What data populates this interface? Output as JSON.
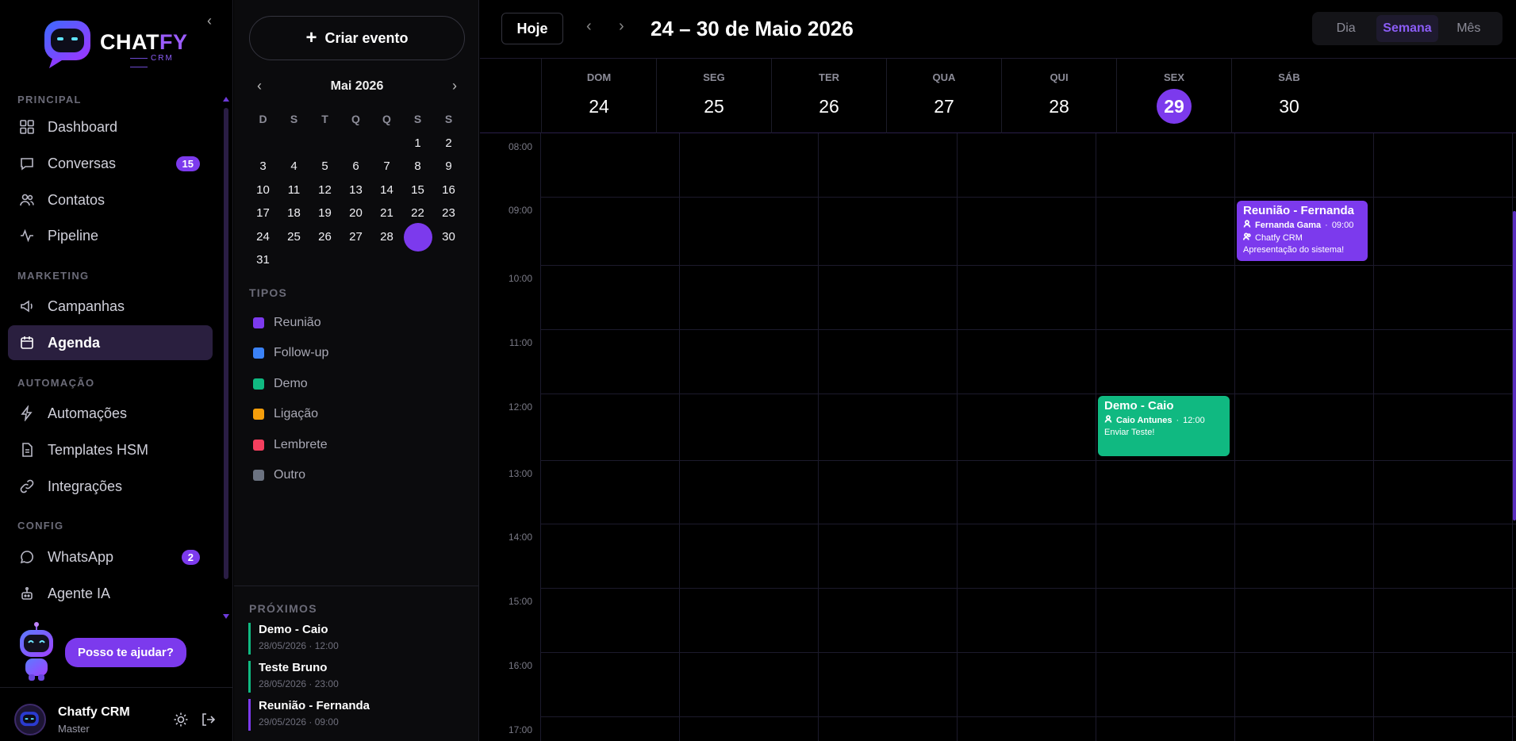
{
  "brand": {
    "name_main": "CHAT",
    "name_accent": "FY",
    "sub": "CRM"
  },
  "sidebar": {
    "collapse_icon": "chevron-left-icon",
    "sections": {
      "principal": "PRINCIPAL",
      "marketing": "MARKETING",
      "automacao": "AUTOMAÇÃO",
      "config": "CONFIG"
    },
    "items": [
      {
        "label": "Dashboard",
        "icon": "grid-icon"
      },
      {
        "label": "Conversas",
        "icon": "chat-icon",
        "badge": "15"
      },
      {
        "label": "Contatos",
        "icon": "users-icon"
      },
      {
        "label": "Pipeline",
        "icon": "activity-icon"
      },
      {
        "label": "Campanhas",
        "icon": "megaphone-icon"
      },
      {
        "label": "Agenda",
        "icon": "calendar-icon",
        "active": true
      },
      {
        "label": "Automações",
        "icon": "bolt-icon"
      },
      {
        "label": "Templates HSM",
        "icon": "file-icon"
      },
      {
        "label": "Integrações",
        "icon": "link-icon"
      },
      {
        "label": "WhatsApp",
        "icon": "whatsapp-icon",
        "badge": "2"
      },
      {
        "label": "Agente IA",
        "icon": "robot-icon"
      }
    ],
    "helper": "Posso te ajudar?",
    "profile": {
      "name": "Chatfy CRM",
      "role": "Master"
    }
  },
  "mini": {
    "create": "Criar evento",
    "month_title": "Mai 2026",
    "dow": [
      "D",
      "S",
      "T",
      "Q",
      "Q",
      "S",
      "S"
    ],
    "weeks": [
      [
        "",
        "",
        "",
        "",
        "",
        "1",
        "2"
      ],
      [
        "3",
        "4",
        "5",
        "6",
        "7",
        "8",
        "9"
      ],
      [
        "10",
        "11",
        "12",
        "13",
        "14",
        "15",
        "16"
      ],
      [
        "17",
        "18",
        "19",
        "20",
        "21",
        "22",
        "23"
      ],
      [
        "24",
        "25",
        "26",
        "27",
        "28",
        "",
        "30"
      ],
      [
        "31",
        "",
        "",
        "",
        "",
        "",
        ""
      ]
    ],
    "selected_day": "29",
    "tipos_title": "TIPOS",
    "tipos": [
      {
        "label": "Reunião",
        "color": "#7c3aed"
      },
      {
        "label": "Follow-up",
        "color": "#3b82f6"
      },
      {
        "label": "Demo",
        "color": "#10b981"
      },
      {
        "label": "Ligação",
        "color": "#f59e0b"
      },
      {
        "label": "Lembrete",
        "color": "#f43f5e"
      },
      {
        "label": "Outro",
        "color": "#6b7280"
      }
    ],
    "proximos_title": "PRÓXIMOS",
    "proximos": [
      {
        "name": "Demo - Caio",
        "date": "28/05/2026 · 12:00",
        "color": "#10b981"
      },
      {
        "name": "Teste Bruno",
        "date": "28/05/2026 · 23:00",
        "color": "#10b981"
      },
      {
        "name": "Reunião - Fernanda",
        "date": "29/05/2026 · 09:00",
        "color": "#7c3aed"
      }
    ]
  },
  "toolbar": {
    "today": "Hoje",
    "prev": "‹",
    "next": "›",
    "range": "24 – 30 de Maio 2026",
    "views": [
      "Dia",
      "Semana",
      "Mês"
    ],
    "active_view": "Semana"
  },
  "week": {
    "days": [
      {
        "dow": "DOM",
        "num": "24"
      },
      {
        "dow": "SEG",
        "num": "25"
      },
      {
        "dow": "TER",
        "num": "26"
      },
      {
        "dow": "QUA",
        "num": "27"
      },
      {
        "dow": "QUI",
        "num": "28"
      },
      {
        "dow": "SEX",
        "num": "29",
        "today": true
      },
      {
        "dow": "SÁB",
        "num": "30"
      }
    ],
    "hours": [
      "08:00",
      "09:00",
      "10:00",
      "11:00",
      "12:00",
      "13:00",
      "14:00",
      "15:00",
      "16:00",
      "17:00"
    ]
  },
  "events": [
    {
      "title": "Reunião - Fernanda",
      "contact": "Fernanda Gama",
      "time": "09:00",
      "org": "Chatfy CRM",
      "note": "Apresentação do sistema!",
      "color": "#7c3aed"
    },
    {
      "title": "Demo - Caio",
      "contact": "Caio Antunes",
      "time": "12:00",
      "note": "Enviar Teste!",
      "color": "#10b981"
    }
  ]
}
